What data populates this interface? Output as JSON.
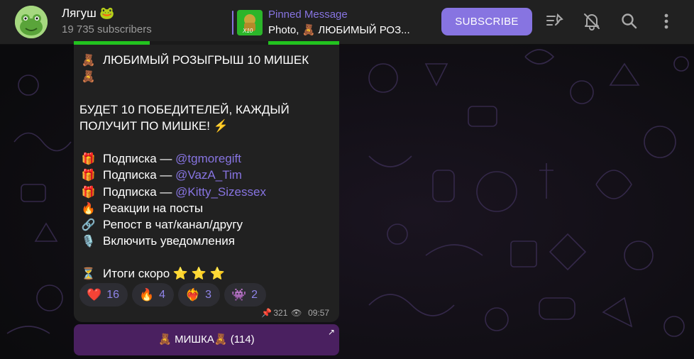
{
  "channel": {
    "title": "Лягуш 🐸",
    "subscribers": "19 735 subscribers",
    "avatar_icon": "frog-avatar"
  },
  "pinned": {
    "label": "Pinned Message",
    "text": "Photo, 🧸 ЛЮБИМЫЙ РОЗ...",
    "thumb_badge": "X10"
  },
  "header": {
    "subscribe_label": "SUBSCRIBE",
    "icons": [
      "pinned-list-icon",
      "mute-bell-icon",
      "search-icon",
      "more-vertical-icon"
    ]
  },
  "message": {
    "lines": [
      {
        "emoji": "🧸",
        "text": "ЛЮБИМЫЙ РОЗЫГРЫШ 10 МИШЕК"
      },
      {
        "emoji": "🧸",
        "text": ""
      },
      {
        "gap": true
      },
      {
        "plain": "БУДЕТ 10 ПОБЕДИТЕЛЕЙ, КАЖДЫЙ"
      },
      {
        "plain": "ПОЛУЧИТ ПО МИШКЕ! ⚡"
      },
      {
        "gap": true
      },
      {
        "emoji": "🎁",
        "text": "Подписка — ",
        "link": "@tgmoregift"
      },
      {
        "emoji": "🎁",
        "text": "Подписка — ",
        "link": "@VazA_Tim"
      },
      {
        "emoji": "🎁",
        "text": "Подписка — ",
        "link": "@Kitty_Sizessex"
      },
      {
        "emoji": "🔥",
        "text": "Реакции на посты"
      },
      {
        "emoji": "🔗",
        "text": "Репост в чат/канал/другу"
      },
      {
        "emoji": "🎙️",
        "text": "Включить уведомления"
      },
      {
        "gap": true
      },
      {
        "emoji": "⏳",
        "text": "Итоги скоро ⭐ ⭐ ⭐"
      }
    ],
    "reactions": [
      {
        "emoji": "❤️",
        "count": "16"
      },
      {
        "emoji": "🔥",
        "count": "4"
      },
      {
        "emoji": "❤️‍🔥",
        "count": "3"
      },
      {
        "emoji": "👾",
        "count": "2"
      }
    ],
    "views": "321",
    "time": "09:57"
  },
  "inline_button": {
    "label": "🧸 МИШКА🧸  (114)"
  },
  "colors": {
    "accent": "#8774e1",
    "header_bg": "#212121",
    "bubble_bg": "#212121",
    "button_bg": "#4a2060",
    "image_green": "#22c31f"
  }
}
